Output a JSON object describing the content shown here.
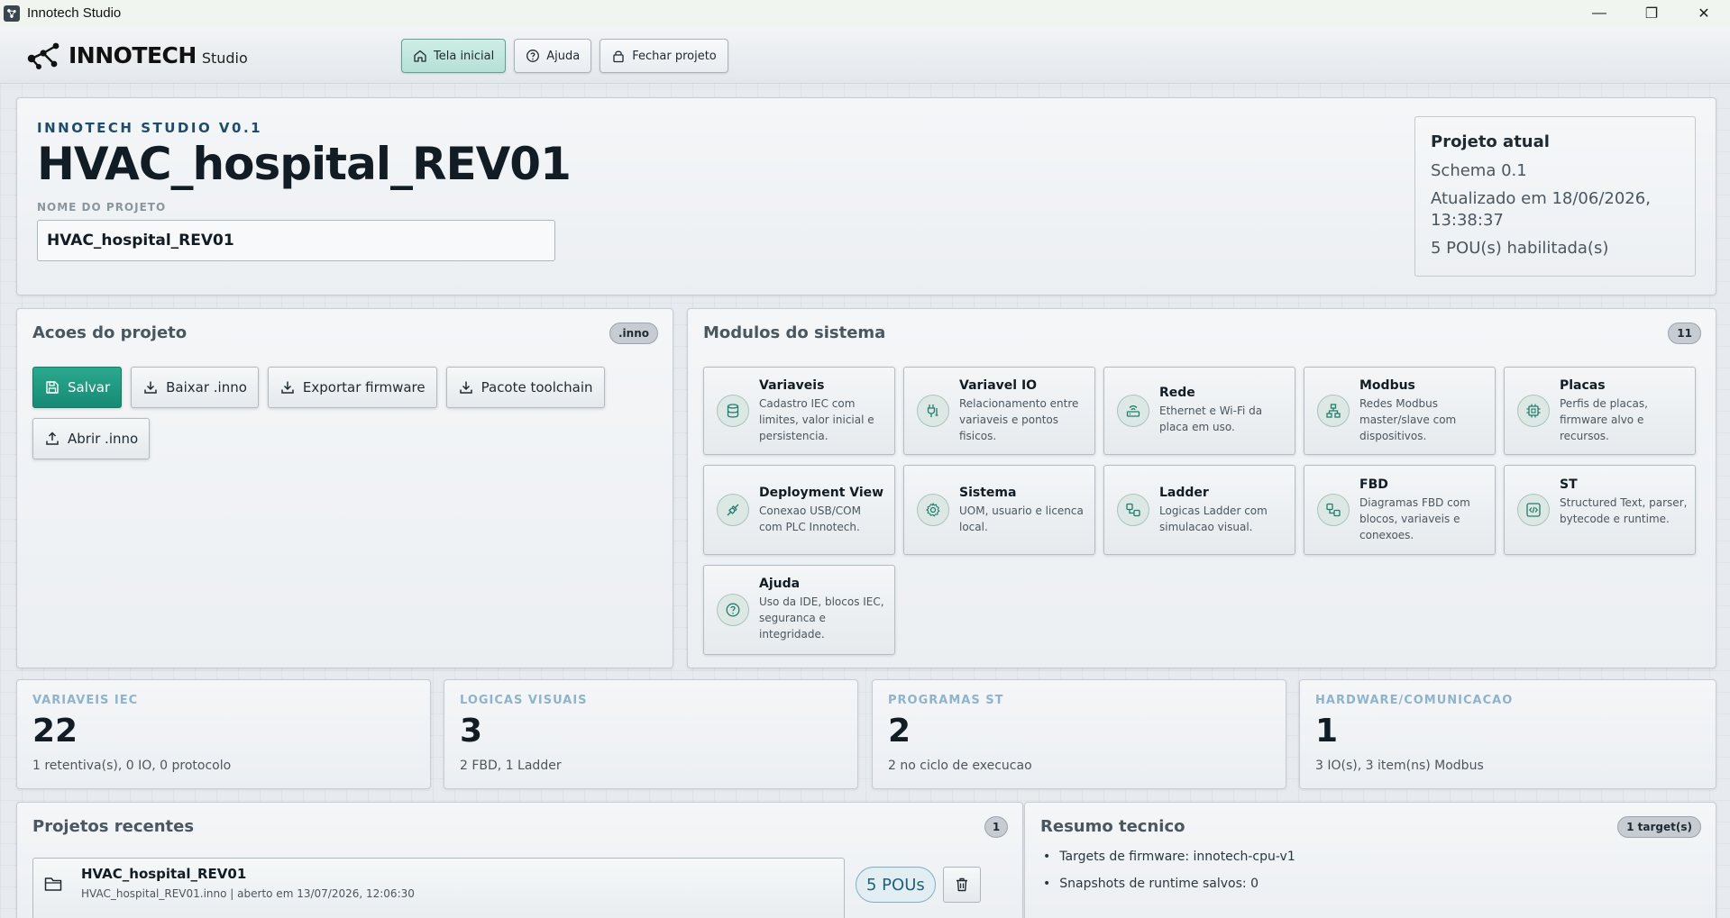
{
  "window": {
    "title": "Innotech Studio",
    "controls": {
      "minimize": "—",
      "restore": "❐",
      "close": "✕"
    }
  },
  "header": {
    "brand": "INNOTECH",
    "brand_sub": "Studio",
    "nav": [
      {
        "label": "Tela inicial",
        "icon": "home-icon",
        "active": true
      },
      {
        "label": "Ajuda",
        "icon": "help-icon",
        "active": false
      },
      {
        "label": "Fechar projeto",
        "icon": "lock-icon",
        "active": false
      }
    ]
  },
  "hero": {
    "tag": "INNOTECH STUDIO V0.1",
    "title": "HVAC_hospital_REV01",
    "field_label": "NOME DO PROJETO",
    "project_name": "HVAC_hospital_REV01"
  },
  "current_project": {
    "title": "Projeto atual",
    "schema": "Schema 0.1",
    "updated_line1": "Atualizado em 18/06/2026,",
    "updated_line2": "13:38:37",
    "pous": "5 POU(s) habilitada(s)"
  },
  "actions": {
    "title": "Acoes do projeto",
    "badge": ".inno",
    "buttons": [
      {
        "label": "Salvar",
        "icon": "save-icon"
      },
      {
        "label": "Baixar .inno",
        "icon": "download-icon"
      },
      {
        "label": "Exportar firmware",
        "icon": "download-icon"
      },
      {
        "label": "Pacote toolchain",
        "icon": "download-icon"
      },
      {
        "label": "Abrir .inno",
        "icon": "upload-icon"
      }
    ]
  },
  "modules": {
    "title": "Modulos do sistema",
    "count": "11",
    "items": [
      {
        "name": "Variaveis",
        "desc": "Cadastro IEC com limites, valor inicial e persistencia.",
        "icon": "database-icon"
      },
      {
        "name": "Variavel IO",
        "desc": "Relacionamento entre variaveis e pontos fisicos.",
        "icon": "plug-icon"
      },
      {
        "name": "Rede",
        "desc": "Ethernet e Wi-Fi da placa em uso.",
        "icon": "router-icon"
      },
      {
        "name": "Modbus",
        "desc": "Redes Modbus master/slave com dispositivos.",
        "icon": "network-icon"
      },
      {
        "name": "Placas",
        "desc": "Perfis de placas, firmware alvo e recursos.",
        "icon": "chip-icon"
      },
      {
        "name": "Deployment View",
        "desc": "Conexao USB/COM com PLC Innotech.",
        "icon": "connection-icon"
      },
      {
        "name": "Sistema",
        "desc": "UOM, usuario e licenca local.",
        "icon": "gear-icon"
      },
      {
        "name": "Ladder",
        "desc": "Logicas Ladder com simulacao visual.",
        "icon": "workflow-icon"
      },
      {
        "name": "FBD",
        "desc": "Diagramas FBD com blocos, variaveis e conexoes.",
        "icon": "workflow-icon"
      },
      {
        "name": "ST",
        "desc": "Structured Text, parser, bytecode e runtime.",
        "icon": "code-icon"
      },
      {
        "name": "Ajuda",
        "desc": "Uso da IDE, blocos IEC, seguranca e integridade.",
        "icon": "help-icon"
      }
    ]
  },
  "stats": [
    {
      "label": "VARIAVEIS IEC",
      "value": "22",
      "sub": "1 retentiva(s), 0 IO, 0 protocolo"
    },
    {
      "label": "LOGICAS VISUAIS",
      "value": "3",
      "sub": "2 FBD, 1 Ladder"
    },
    {
      "label": "PROGRAMAS ST",
      "value": "2",
      "sub": "2 no ciclo de execucao"
    },
    {
      "label": "HARDWARE/COMUNICACAO",
      "value": "1",
      "sub": "3 IO(s), 3 item(ns) Modbus"
    }
  ],
  "recent": {
    "title": "Projetos recentes",
    "count": "1",
    "items": [
      {
        "name": "HVAC_hospital_REV01",
        "meta": "HVAC_hospital_REV01.inno | aberto em 13/07/2026, 12:06:30",
        "pous": "5 POUs"
      }
    ]
  },
  "summary": {
    "title": "Resumo tecnico",
    "badge": "1 target(s)",
    "items": [
      "Targets de firmware: innotech-cpu-v1",
      "Snapshots de runtime salvos: 0"
    ]
  },
  "colors": {
    "accent": "#1f9c82",
    "accent_dark": "#157a66",
    "stat_label": "#8fb3ce"
  }
}
